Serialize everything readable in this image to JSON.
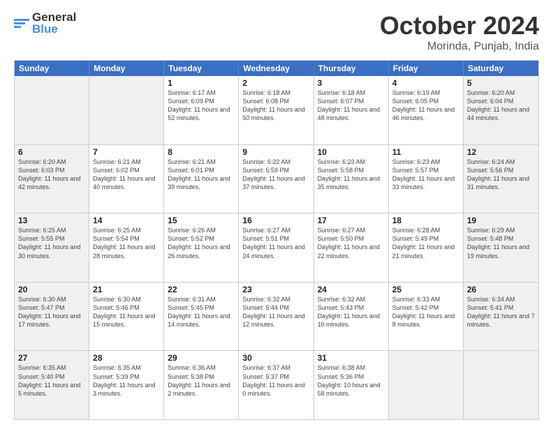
{
  "logo": {
    "line1": "General",
    "line2": "Blue"
  },
  "title": "October 2024",
  "location": "Morinda, Punjab, India",
  "days_of_week": [
    "Sunday",
    "Monday",
    "Tuesday",
    "Wednesday",
    "Thursday",
    "Friday",
    "Saturday"
  ],
  "weeks": [
    [
      {
        "day": "",
        "sunrise": "",
        "sunset": "",
        "daylight": "",
        "shaded": true
      },
      {
        "day": "",
        "sunrise": "",
        "sunset": "",
        "daylight": "",
        "shaded": true
      },
      {
        "day": "1",
        "sunrise": "Sunrise: 6:17 AM",
        "sunset": "Sunset: 6:09 PM",
        "daylight": "Daylight: 11 hours and 52 minutes.",
        "shaded": false
      },
      {
        "day": "2",
        "sunrise": "Sunrise: 6:18 AM",
        "sunset": "Sunset: 6:08 PM",
        "daylight": "Daylight: 11 hours and 50 minutes.",
        "shaded": false
      },
      {
        "day": "3",
        "sunrise": "Sunrise: 6:18 AM",
        "sunset": "Sunset: 6:07 PM",
        "daylight": "Daylight: 11 hours and 48 minutes.",
        "shaded": false
      },
      {
        "day": "4",
        "sunrise": "Sunrise: 6:19 AM",
        "sunset": "Sunset: 6:05 PM",
        "daylight": "Daylight: 11 hours and 46 minutes.",
        "shaded": false
      },
      {
        "day": "5",
        "sunrise": "Sunrise: 6:20 AM",
        "sunset": "Sunset: 6:04 PM",
        "daylight": "Daylight: 11 hours and 44 minutes.",
        "shaded": true
      }
    ],
    [
      {
        "day": "6",
        "sunrise": "Sunrise: 6:20 AM",
        "sunset": "Sunset: 6:03 PM",
        "daylight": "Daylight: 11 hours and 42 minutes.",
        "shaded": true
      },
      {
        "day": "7",
        "sunrise": "Sunrise: 6:21 AM",
        "sunset": "Sunset: 6:02 PM",
        "daylight": "Daylight: 11 hours and 40 minutes.",
        "shaded": false
      },
      {
        "day": "8",
        "sunrise": "Sunrise: 6:21 AM",
        "sunset": "Sunset: 6:01 PM",
        "daylight": "Daylight: 11 hours and 39 minutes.",
        "shaded": false
      },
      {
        "day": "9",
        "sunrise": "Sunrise: 6:22 AM",
        "sunset": "Sunset: 5:59 PM",
        "daylight": "Daylight: 11 hours and 37 minutes.",
        "shaded": false
      },
      {
        "day": "10",
        "sunrise": "Sunrise: 6:23 AM",
        "sunset": "Sunset: 5:58 PM",
        "daylight": "Daylight: 11 hours and 35 minutes.",
        "shaded": false
      },
      {
        "day": "11",
        "sunrise": "Sunrise: 6:23 AM",
        "sunset": "Sunset: 5:57 PM",
        "daylight": "Daylight: 11 hours and 33 minutes.",
        "shaded": false
      },
      {
        "day": "12",
        "sunrise": "Sunrise: 6:24 AM",
        "sunset": "Sunset: 5:56 PM",
        "daylight": "Daylight: 11 hours and 31 minutes.",
        "shaded": true
      }
    ],
    [
      {
        "day": "13",
        "sunrise": "Sunrise: 6:25 AM",
        "sunset": "Sunset: 5:55 PM",
        "daylight": "Daylight: 11 hours and 30 minutes.",
        "shaded": true
      },
      {
        "day": "14",
        "sunrise": "Sunrise: 6:25 AM",
        "sunset": "Sunset: 5:54 PM",
        "daylight": "Daylight: 11 hours and 28 minutes.",
        "shaded": false
      },
      {
        "day": "15",
        "sunrise": "Sunrise: 6:26 AM",
        "sunset": "Sunset: 5:52 PM",
        "daylight": "Daylight: 11 hours and 26 minutes.",
        "shaded": false
      },
      {
        "day": "16",
        "sunrise": "Sunrise: 6:27 AM",
        "sunset": "Sunset: 5:51 PM",
        "daylight": "Daylight: 11 hours and 24 minutes.",
        "shaded": false
      },
      {
        "day": "17",
        "sunrise": "Sunrise: 6:27 AM",
        "sunset": "Sunset: 5:50 PM",
        "daylight": "Daylight: 11 hours and 22 minutes.",
        "shaded": false
      },
      {
        "day": "18",
        "sunrise": "Sunrise: 6:28 AM",
        "sunset": "Sunset: 5:49 PM",
        "daylight": "Daylight: 11 hours and 21 minutes.",
        "shaded": false
      },
      {
        "day": "19",
        "sunrise": "Sunrise: 6:29 AM",
        "sunset": "Sunset: 5:48 PM",
        "daylight": "Daylight: 11 hours and 19 minutes.",
        "shaded": true
      }
    ],
    [
      {
        "day": "20",
        "sunrise": "Sunrise: 6:30 AM",
        "sunset": "Sunset: 5:47 PM",
        "daylight": "Daylight: 11 hours and 17 minutes.",
        "shaded": true
      },
      {
        "day": "21",
        "sunrise": "Sunrise: 6:30 AM",
        "sunset": "Sunset: 5:46 PM",
        "daylight": "Daylight: 11 hours and 15 minutes.",
        "shaded": false
      },
      {
        "day": "22",
        "sunrise": "Sunrise: 6:31 AM",
        "sunset": "Sunset: 5:45 PM",
        "daylight": "Daylight: 11 hours and 14 minutes.",
        "shaded": false
      },
      {
        "day": "23",
        "sunrise": "Sunrise: 6:32 AM",
        "sunset": "Sunset: 5:44 PM",
        "daylight": "Daylight: 11 hours and 12 minutes.",
        "shaded": false
      },
      {
        "day": "24",
        "sunrise": "Sunrise: 6:32 AM",
        "sunset": "Sunset: 5:43 PM",
        "daylight": "Daylight: 11 hours and 10 minutes.",
        "shaded": false
      },
      {
        "day": "25",
        "sunrise": "Sunrise: 6:33 AM",
        "sunset": "Sunset: 5:42 PM",
        "daylight": "Daylight: 11 hours and 8 minutes.",
        "shaded": false
      },
      {
        "day": "26",
        "sunrise": "Sunrise: 6:34 AM",
        "sunset": "Sunset: 5:41 PM",
        "daylight": "Daylight: 11 hours and 7 minutes.",
        "shaded": true
      }
    ],
    [
      {
        "day": "27",
        "sunrise": "Sunrise: 6:35 AM",
        "sunset": "Sunset: 5:40 PM",
        "daylight": "Daylight: 11 hours and 5 minutes.",
        "shaded": true
      },
      {
        "day": "28",
        "sunrise": "Sunrise: 6:35 AM",
        "sunset": "Sunset: 5:39 PM",
        "daylight": "Daylight: 11 hours and 3 minutes.",
        "shaded": false
      },
      {
        "day": "29",
        "sunrise": "Sunrise: 6:36 AM",
        "sunset": "Sunset: 5:38 PM",
        "daylight": "Daylight: 11 hours and 2 minutes.",
        "shaded": false
      },
      {
        "day": "30",
        "sunrise": "Sunrise: 6:37 AM",
        "sunset": "Sunset: 5:37 PM",
        "daylight": "Daylight: 11 hours and 0 minutes.",
        "shaded": false
      },
      {
        "day": "31",
        "sunrise": "Sunrise: 6:38 AM",
        "sunset": "Sunset: 5:36 PM",
        "daylight": "Daylight: 10 hours and 58 minutes.",
        "shaded": false
      },
      {
        "day": "",
        "sunrise": "",
        "sunset": "",
        "daylight": "",
        "shaded": true
      },
      {
        "day": "",
        "sunrise": "",
        "sunset": "",
        "daylight": "",
        "shaded": true
      }
    ]
  ]
}
